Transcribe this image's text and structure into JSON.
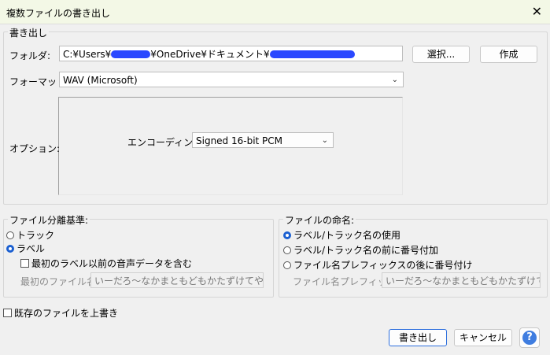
{
  "window": {
    "title": "複数ファイルの書き出し",
    "close_glyph": "✕"
  },
  "export_group": {
    "legend": "書き出し",
    "folder_label": "フォルダ:",
    "folder_path_prefix": "C:¥Users¥",
    "folder_path_middle": "¥OneDrive¥ドキュメント¥",
    "select_button": "選択...",
    "create_button": "作成",
    "format_label": "フォーマット:",
    "format_value": "WAV (Microsoft)",
    "options_label": "オプション:",
    "encoding_label": "エンコーディング:",
    "encoding_value": "Signed 16-bit PCM"
  },
  "split_group": {
    "legend": "ファイル分離基準:",
    "options": [
      "トラック",
      "ラベル"
    ],
    "selected": "ラベル",
    "include_audio_label": "最初のラベル以前の音声データを含む",
    "first_file_label": "最初のファイル名:",
    "first_file_value": "いーだろ～なかまともどもかたずけてやる [vocals"
  },
  "naming_group": {
    "legend": "ファイルの命名:",
    "options": [
      "ラベル/トラック名の使用",
      "ラベル/トラック名の前に番号付加",
      "ファイル名プレフィックスの後に番号付け"
    ],
    "selected": "ラベル/トラック名の使用",
    "prefix_label": "ファイル名プレフィックス:",
    "prefix_value": "いーだろ～なかまともどもかたずけてやる [vo"
  },
  "overwrite_label": "既存のファイルを上書き",
  "footer": {
    "export_button": "書き出し",
    "cancel_button": "キャンセル",
    "help_glyph": "?"
  },
  "colors": {
    "redaction": "#2a48ff",
    "accent": "#1a5fd1",
    "titlebar": "#f3f8e6"
  }
}
